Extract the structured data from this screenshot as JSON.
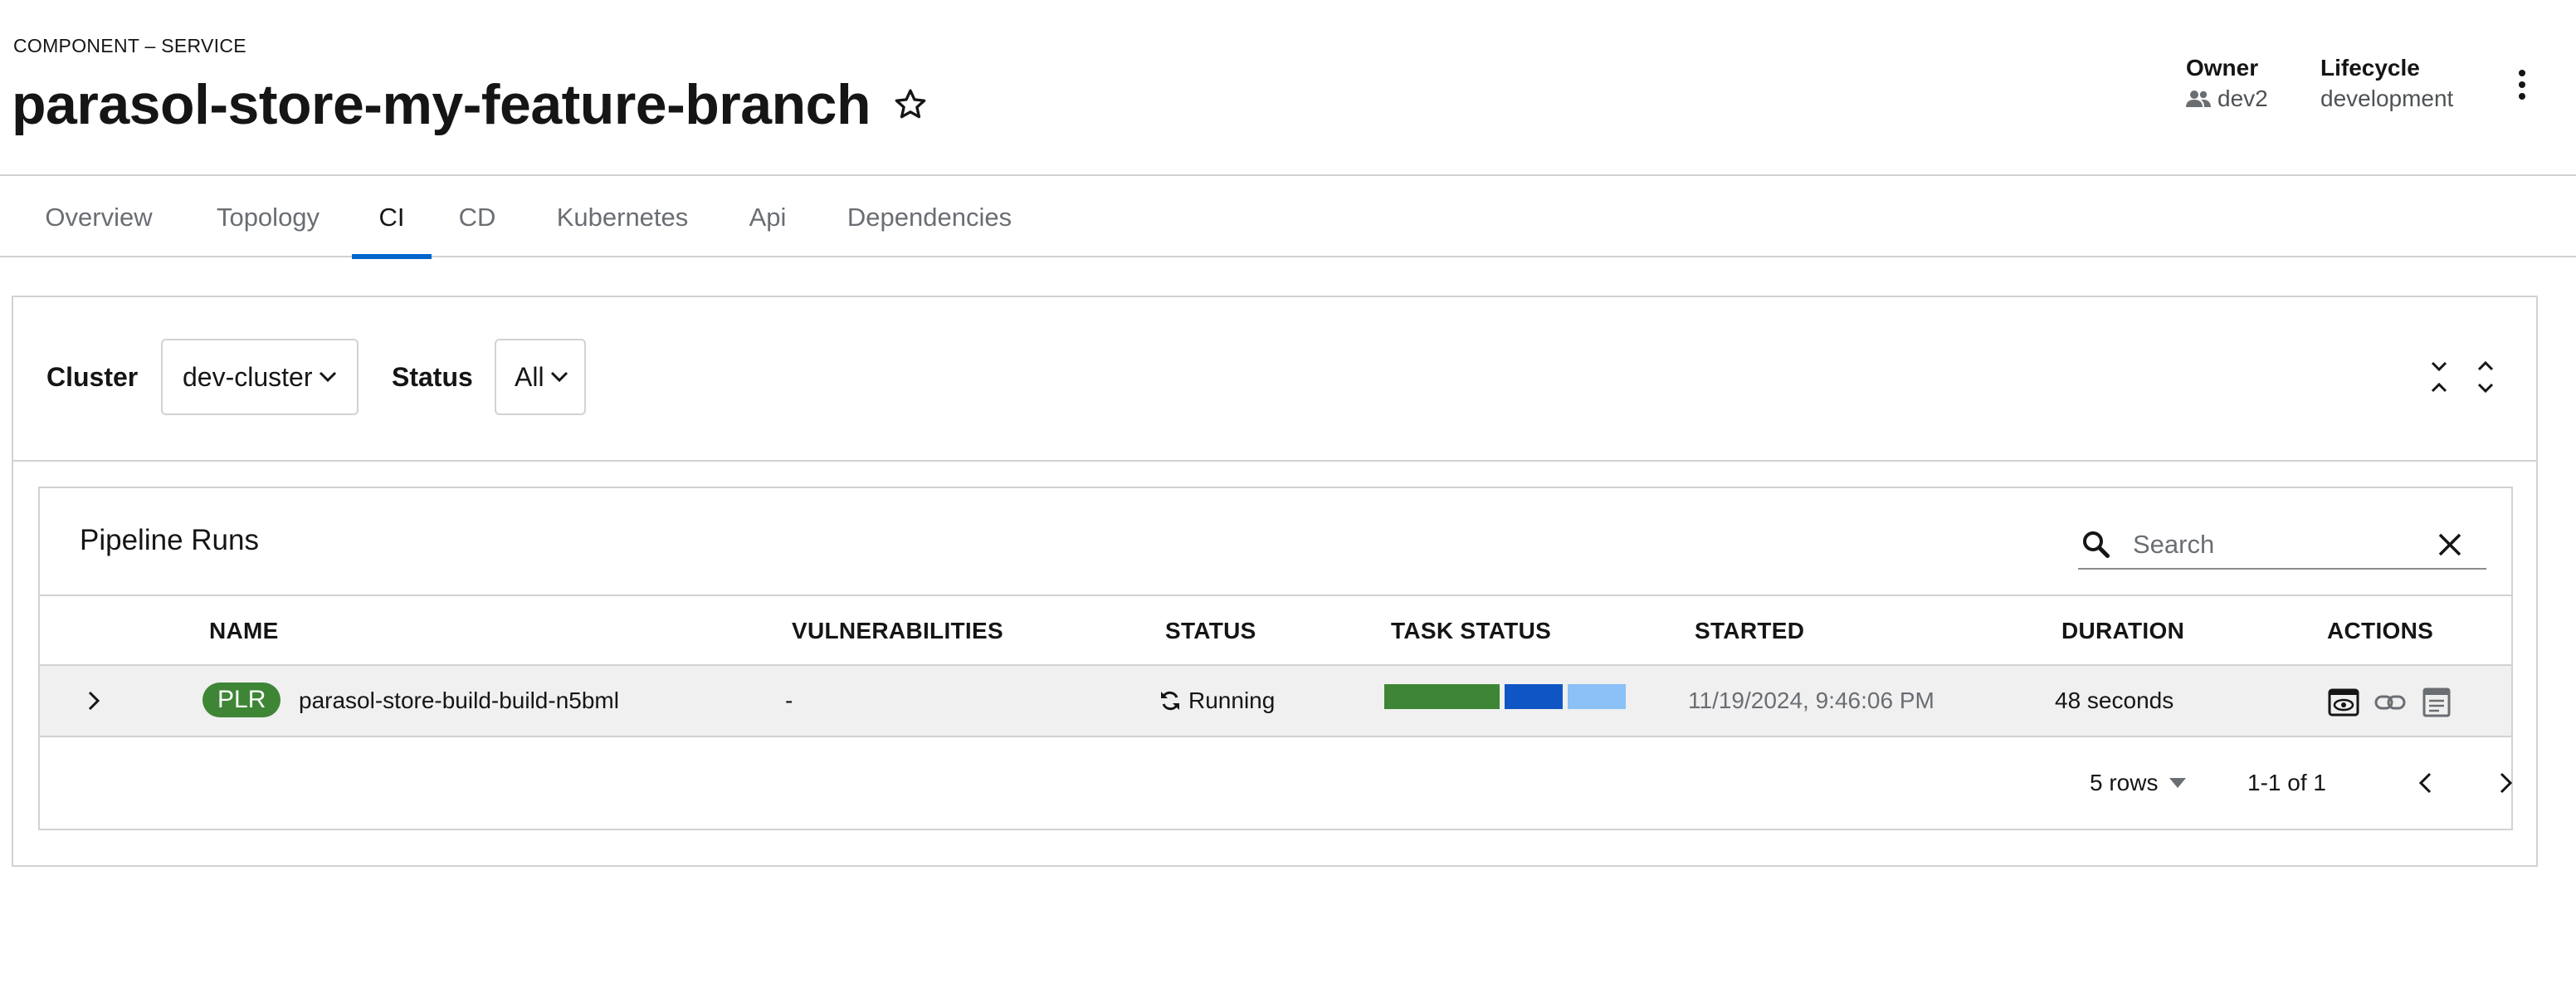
{
  "header": {
    "kind": "COMPONENT – SERVICE",
    "title": "parasol-store-my-feature-branch",
    "owner_label": "Owner",
    "owner_value": "dev2",
    "lifecycle_label": "Lifecycle",
    "lifecycle_value": "development"
  },
  "tabs": [
    {
      "label": "Overview",
      "active": false
    },
    {
      "label": "Topology",
      "active": false
    },
    {
      "label": "CI",
      "active": true
    },
    {
      "label": "CD",
      "active": false
    },
    {
      "label": "Kubernetes",
      "active": false
    },
    {
      "label": "Api",
      "active": false
    },
    {
      "label": "Dependencies",
      "active": false
    }
  ],
  "filters": {
    "cluster_label": "Cluster",
    "cluster_value": "dev-cluster",
    "status_label": "Status",
    "status_value": "All"
  },
  "card": {
    "title": "Pipeline Runs",
    "search_placeholder": "Search"
  },
  "table": {
    "columns": [
      "NAME",
      "VULNERABILITIES",
      "STATUS",
      "TASK STATUS",
      "STARTED",
      "DURATION",
      "ACTIONS"
    ],
    "rows": [
      {
        "badge": "PLR",
        "name": "parasol-store-build-build-n5bml",
        "vulnerabilities": "-",
        "status": "Running",
        "task_status": [
          {
            "state": "succeeded",
            "fraction": 0.5,
            "color": "#3e8635"
          },
          {
            "state": "running",
            "fraction": 0.25,
            "color": "#0f55c4"
          },
          {
            "state": "pending",
            "fraction": 0.25,
            "color": "#8bc1f7"
          }
        ],
        "started": "11/19/2024, 9:46:06 PM",
        "duration": "48 seconds"
      }
    ]
  },
  "pagination": {
    "per_page": "5 rows",
    "range": "1-1 of 1"
  },
  "colors": {
    "accent": "#0066cc",
    "badge": "#3e8635",
    "border": "#d2d2d2",
    "row_background": "#f0f0f0"
  },
  "icons": [
    "star-icon",
    "owner-group-icon",
    "kebab-icon",
    "chevron-down-icon",
    "collapse-all-icon",
    "expand-all-icon",
    "search-icon",
    "close-icon",
    "expand-row-icon",
    "running-sync-icon",
    "view-output-icon",
    "link-icon",
    "view-logs-icon",
    "prev-page-icon",
    "next-page-icon"
  ]
}
